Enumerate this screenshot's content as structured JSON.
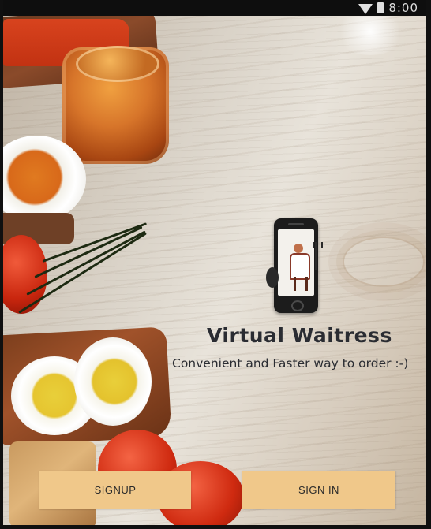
{
  "status_bar": {
    "time": "8:00",
    "icons": [
      "wifi-icon",
      "battery-icon"
    ]
  },
  "app": {
    "title": "Virtual Waitress",
    "tagline": "Convenient and Faster way to order :-)",
    "logo_icon": "waitress-phone-logo"
  },
  "buttons": {
    "signup_label": "SIGNUP",
    "signin_label": "SIGN IN"
  },
  "colors": {
    "button_background": "#f0c88a",
    "title_text": "#2a2c32",
    "status_bar": "#0e0e0e"
  }
}
